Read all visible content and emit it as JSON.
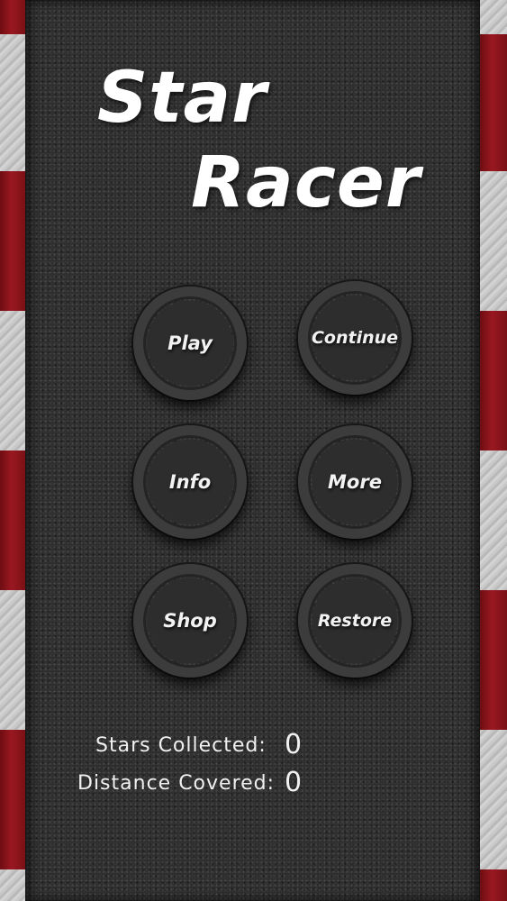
{
  "title": {
    "line1": "Star",
    "line2": "Racer"
  },
  "buttons": {
    "play": "Play",
    "continue": "Continue",
    "info": "Info",
    "more": "More",
    "shop": "Shop",
    "restore": "Restore"
  },
  "stats": {
    "stars_label": "Stars Collected:",
    "stars_value": "0",
    "distance_label": "Distance Covered:",
    "distance_value": "0"
  },
  "colors": {
    "curb_red": "#8a141b",
    "curb_white": "#c4c4c4",
    "asphalt": "#2b2b2b",
    "text": "#ffffff"
  }
}
